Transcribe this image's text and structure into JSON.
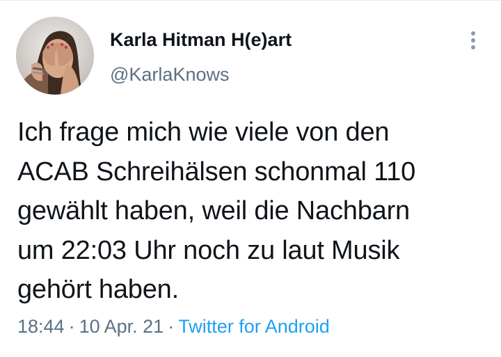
{
  "author": {
    "display_name": "Karla Hitman H(e)art",
    "handle": "@KarlaKnows"
  },
  "icons": {
    "menu": "more-vertical-icon",
    "avatar": "profile-avatar"
  },
  "tweet": {
    "lines": [
      "Ich frage mich wie viele von den",
      "ACAB Schreihälsen schonmal 110",
      "gewählt haben, weil die Nachbarn",
      "um 22:03 Uhr noch zu laut Musik",
      "gehört haben."
    ]
  },
  "meta": {
    "time": "18:44",
    "separator": "·",
    "date": "10 Apr. 21",
    "source": "Twitter for Android"
  },
  "colors": {
    "text": "#0f1419",
    "secondary": "#5b7083",
    "link": "#1da1f2"
  }
}
